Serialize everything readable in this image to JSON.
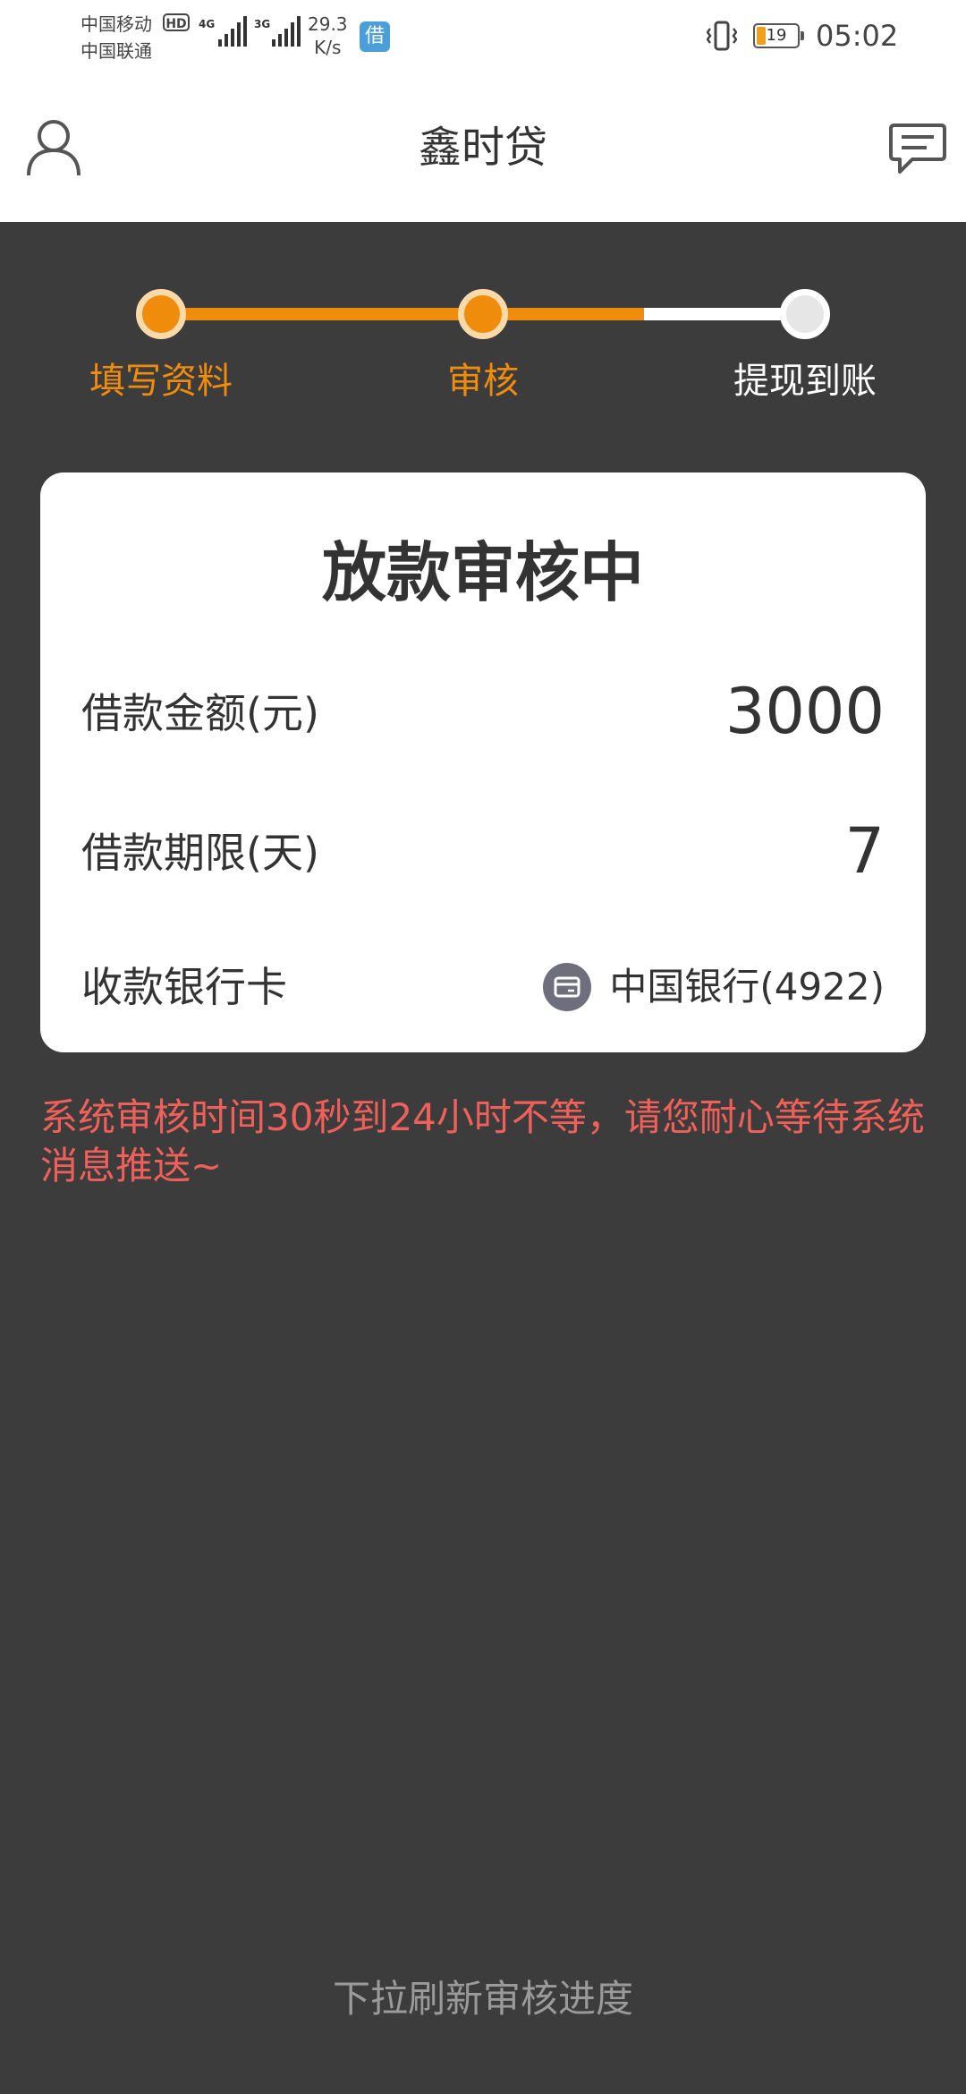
{
  "status_bar": {
    "carrier_1": "中国移动",
    "hd_label": "HD",
    "carrier_2": "中国联通",
    "network_1": "4G",
    "network_2": "3G",
    "speed_value": "29.3",
    "speed_unit": "K/s",
    "app_badge": "借",
    "battery_level": "19",
    "time": "05:02"
  },
  "header": {
    "title": "鑫时贷",
    "left_icon": "user-icon",
    "right_icon": "message-icon"
  },
  "stepper": {
    "steps": [
      {
        "label": "填写资料",
        "state": "done"
      },
      {
        "label": "审核",
        "state": "current"
      },
      {
        "label": "提现到账",
        "state": "pending"
      }
    ],
    "accent_color": "#f08c0c"
  },
  "card": {
    "title": "放款审核中",
    "rows": [
      {
        "label": "借款金额(元)",
        "value": "3000"
      },
      {
        "label": "借款期限(天)",
        "value": "7"
      },
      {
        "label": "收款银行卡",
        "value": "中国银行(4922)",
        "icon": "bank-card-icon"
      }
    ]
  },
  "notice": "系统审核时间30秒到24小时不等，请您耐心等待系统消息推送~",
  "refresh_hint": "下拉刷新审核进度"
}
